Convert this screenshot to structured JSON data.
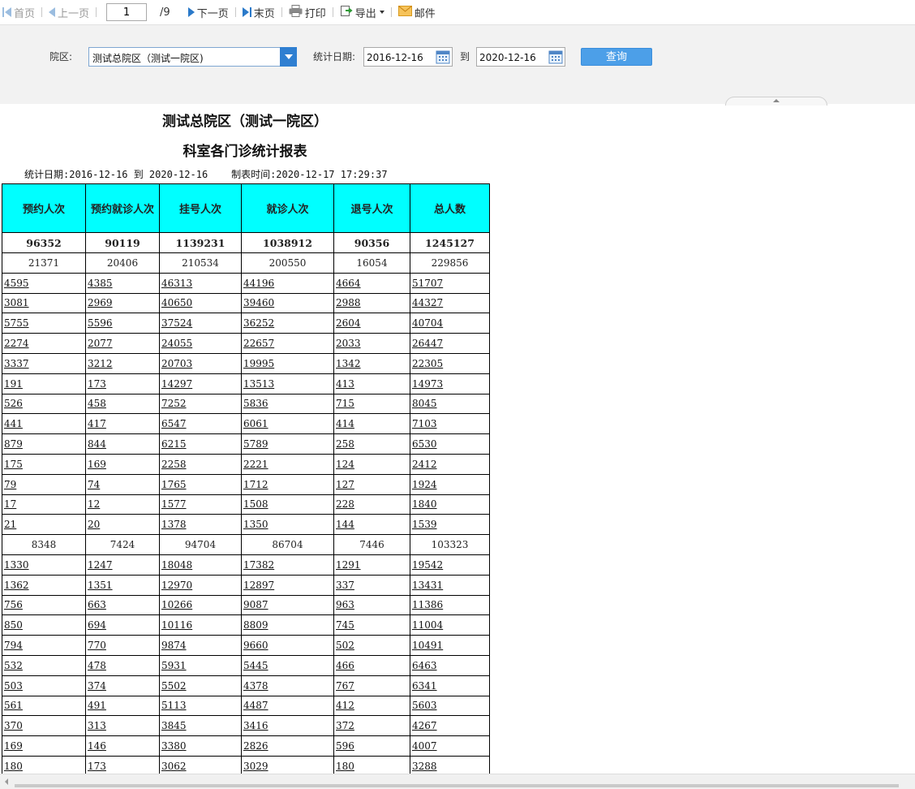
{
  "toolbar": {
    "first_page": "首页",
    "prev_page": "上一页",
    "current_page": "1",
    "total_pages": "/9",
    "next_page": "下一页",
    "last_page": "末页",
    "print": "打印",
    "export": "导出",
    "mail": "邮件"
  },
  "filter": {
    "campus_label": "院区:",
    "campus_value": "测试总院区（测试一院区)",
    "date_label": "统计日期:",
    "date_from": "2016-12-16",
    "to_label": "到",
    "date_to": "2020-12-16",
    "query_button": "查询"
  },
  "report": {
    "title_line1": "测试总院区（测试一院区）",
    "title_line2": "科室各门诊统计报表",
    "meta": "统计日期:2016-12-16 到 2020-12-16    制表时间:2020-12-17 17:29:37",
    "headers": [
      "预约人次",
      "预约就诊人次",
      "挂号人次",
      "就诊人次",
      "退号人次",
      "总人数"
    ],
    "rows": [
      {
        "type": "total",
        "cells": [
          "96352",
          "90119",
          "1139231",
          "1038912",
          "90356",
          "1245127"
        ]
      },
      {
        "type": "group",
        "cells": [
          "21371",
          "20406",
          "210534",
          "200550",
          "16054",
          "229856"
        ]
      },
      {
        "type": "leaf",
        "cells": [
          "4595",
          "4385",
          "46313",
          "44196",
          "4664",
          "51707"
        ]
      },
      {
        "type": "leaf",
        "cells": [
          "3081",
          "2969",
          "40650",
          "39460",
          "2988",
          "44327"
        ]
      },
      {
        "type": "leaf",
        "cells": [
          "5755",
          "5596",
          "37524",
          "36252",
          "2604",
          "40704"
        ]
      },
      {
        "type": "leaf",
        "cells": [
          "2274",
          "2077",
          "24055",
          "22657",
          "2033",
          "26447"
        ]
      },
      {
        "type": "leaf",
        "cells": [
          "3337",
          "3212",
          "20703",
          "19995",
          "1342",
          "22305"
        ]
      },
      {
        "type": "leaf",
        "cells": [
          "191",
          "173",
          "14297",
          "13513",
          "413",
          "14973"
        ]
      },
      {
        "type": "leaf",
        "cells": [
          "526",
          "458",
          "7252",
          "5836",
          "715",
          "8045"
        ]
      },
      {
        "type": "leaf",
        "cells": [
          "441",
          "417",
          "6547",
          "6061",
          "414",
          "7103"
        ]
      },
      {
        "type": "leaf",
        "cells": [
          "879",
          "844",
          "6215",
          "5789",
          "258",
          "6530"
        ]
      },
      {
        "type": "leaf",
        "cells": [
          "175",
          "169",
          "2258",
          "2221",
          "124",
          "2412"
        ]
      },
      {
        "type": "leaf",
        "cells": [
          "79",
          "74",
          "1765",
          "1712",
          "127",
          "1924"
        ]
      },
      {
        "type": "leaf",
        "cells": [
          "17",
          "12",
          "1577",
          "1508",
          "228",
          "1840"
        ]
      },
      {
        "type": "leaf",
        "cells": [
          "21",
          "20",
          "1378",
          "1350",
          "144",
          "1539"
        ]
      },
      {
        "type": "group",
        "cells": [
          "8348",
          "7424",
          "94704",
          "86704",
          "7446",
          "103323"
        ]
      },
      {
        "type": "leaf",
        "cells": [
          "1330",
          "1247",
          "18048",
          "17382",
          "1291",
          "19542"
        ]
      },
      {
        "type": "leaf",
        "cells": [
          "1362",
          "1351",
          "12970",
          "12897",
          "337",
          "13431"
        ]
      },
      {
        "type": "leaf",
        "cells": [
          "756",
          "663",
          "10266",
          "9087",
          "963",
          "11386"
        ]
      },
      {
        "type": "leaf",
        "cells": [
          "850",
          "694",
          "10116",
          "8809",
          "745",
          "11004"
        ]
      },
      {
        "type": "leaf",
        "cells": [
          "794",
          "770",
          "9874",
          "9660",
          "502",
          "10491"
        ]
      },
      {
        "type": "leaf",
        "cells": [
          "532",
          "478",
          "5931",
          "5445",
          "466",
          "6463"
        ]
      },
      {
        "type": "leaf",
        "cells": [
          "503",
          "374",
          "5502",
          "4378",
          "767",
          "6341"
        ]
      },
      {
        "type": "leaf",
        "cells": [
          "561",
          "491",
          "5113",
          "4487",
          "412",
          "5603"
        ]
      },
      {
        "type": "leaf",
        "cells": [
          "370",
          "313",
          "3845",
          "3416",
          "372",
          "4267"
        ]
      },
      {
        "type": "leaf",
        "cells": [
          "169",
          "146",
          "3380",
          "2826",
          "596",
          "4007"
        ]
      },
      {
        "type": "leaf",
        "cells": [
          "180",
          "173",
          "3062",
          "3029",
          "180",
          "3288"
        ]
      }
    ]
  },
  "colors": {
    "header_bg": "#00ffff",
    "accent": "#2f7fd1",
    "query_button_bg": "#4c9fe8",
    "panel_bg": "#f2f2f2"
  },
  "icons": [
    "first-page-icon",
    "prev-page-icon",
    "next-page-icon",
    "last-page-icon",
    "print-icon",
    "export-icon",
    "mail-icon",
    "dropdown-arrow-icon",
    "calendar-icon"
  ]
}
